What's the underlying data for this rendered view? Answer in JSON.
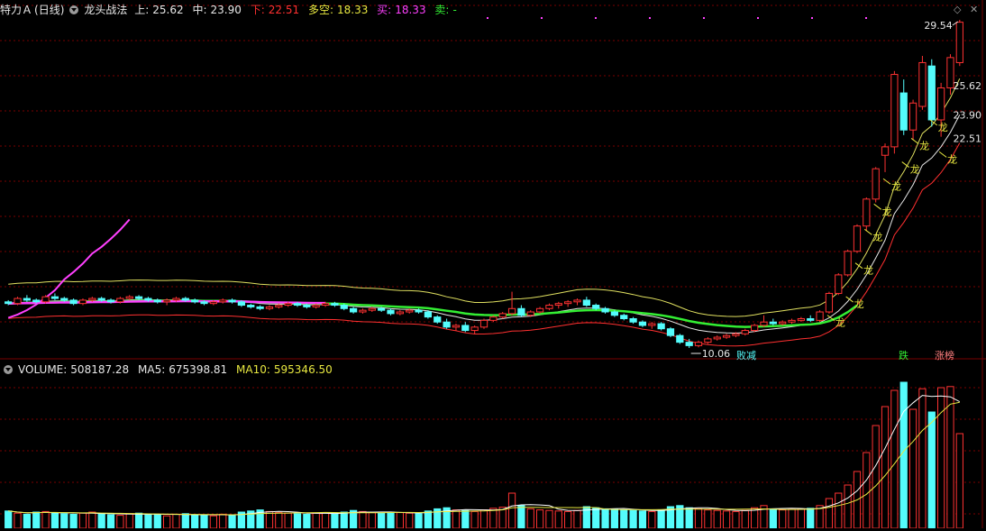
{
  "header": {
    "stock": "特力Ａ",
    "period": "(日线)",
    "indicator": "龙头战法",
    "upper_label": "上:",
    "upper_value": "25.62",
    "mid_label": "中:",
    "mid_value": "23.90",
    "lower_label": "下:",
    "lower_value": "22.51",
    "duokong_label": "多空:",
    "duokong_value": "18.33",
    "buy_label": "买:",
    "buy_value": "18.33",
    "sell_label": "卖:",
    "sell_value": "-"
  },
  "volume_header": {
    "label": "VOLUME:",
    "value": "508187.28",
    "ma5_label": "MA5:",
    "ma5_value": "675398.81",
    "ma10_label": "MA10:",
    "ma10_value": "595346.50"
  },
  "annotations": {
    "high_price": "29.54",
    "low_price": "10.06",
    "axis_upper": "25.62",
    "axis_mid": "23.90",
    "axis_lower": "22.51",
    "marker_long": "龙",
    "marker_bai": "败减",
    "marker_die": "跌",
    "marker_zhang": "涨榜"
  },
  "colors": {
    "up": "#ff3232",
    "down": "#54fcfc",
    "upper_band": "#e0e060",
    "mid_band": "#e8e8e8",
    "lower_band": "#ff3030",
    "duokong": "#ff40ff",
    "trend": "#33ee33",
    "ma5": "#ffffff",
    "ma10": "#e8e840",
    "grid": "#7a0000",
    "header_yellow": "#e8e840",
    "header_red": "#ff3030",
    "header_magenta": "#ff40ff",
    "header_green": "#33ee33"
  },
  "icons": {
    "dropdown": "chevron-down-icon",
    "diamond": "diamond-icon",
    "close": "close-icon"
  },
  "chart_data": {
    "type": "candlestick",
    "ylim": [
      10.06,
      29.54
    ],
    "candles": [
      [
        12.8,
        12.9,
        12.6,
        12.7
      ],
      [
        12.7,
        13.1,
        12.6,
        13.0
      ],
      [
        13.0,
        13.2,
        12.8,
        12.9
      ],
      [
        12.9,
        13.0,
        12.7,
        12.8
      ],
      [
        12.8,
        13.2,
        12.7,
        13.1
      ],
      [
        13.1,
        13.3,
        12.9,
        13.0
      ],
      [
        13.0,
        13.1,
        12.8,
        12.9
      ],
      [
        12.9,
        13.0,
        12.6,
        12.7
      ],
      [
        12.7,
        13.0,
        12.6,
        12.9
      ],
      [
        12.9,
        13.1,
        12.8,
        13.0
      ],
      [
        13.0,
        13.1,
        12.8,
        12.9
      ],
      [
        12.9,
        13.0,
        12.7,
        12.8
      ],
      [
        12.8,
        13.1,
        12.7,
        13.0
      ],
      [
        13.0,
        13.2,
        12.9,
        13.1
      ],
      [
        13.1,
        13.2,
        12.9,
        13.0
      ],
      [
        13.0,
        13.1,
        12.8,
        12.9
      ],
      [
        12.9,
        13.0,
        12.7,
        12.8
      ],
      [
        12.8,
        13.0,
        12.6,
        12.9
      ],
      [
        12.9,
        13.1,
        12.8,
        13.0
      ],
      [
        13.0,
        13.1,
        12.8,
        12.9
      ],
      [
        12.9,
        13.0,
        12.7,
        12.8
      ],
      [
        12.8,
        12.9,
        12.6,
        12.7
      ],
      [
        12.7,
        12.9,
        12.6,
        12.8
      ],
      [
        12.8,
        13.0,
        12.7,
        12.9
      ],
      [
        12.9,
        13.0,
        12.7,
        12.8
      ],
      [
        12.8,
        12.9,
        12.5,
        12.6
      ],
      [
        12.6,
        12.7,
        12.4,
        12.5
      ],
      [
        12.5,
        12.6,
        12.3,
        12.4
      ],
      [
        12.4,
        12.6,
        12.3,
        12.5
      ],
      [
        12.5,
        12.7,
        12.4,
        12.6
      ],
      [
        12.6,
        12.8,
        12.5,
        12.7
      ],
      [
        12.7,
        12.8,
        12.5,
        12.6
      ],
      [
        12.6,
        12.7,
        12.4,
        12.5
      ],
      [
        12.5,
        12.7,
        12.4,
        12.6
      ],
      [
        12.6,
        12.8,
        12.5,
        12.7
      ],
      [
        12.7,
        12.8,
        12.5,
        12.6
      ],
      [
        12.6,
        12.7,
        12.3,
        12.4
      ],
      [
        12.4,
        12.5,
        12.1,
        12.2
      ],
      [
        12.2,
        12.4,
        12.1,
        12.3
      ],
      [
        12.3,
        12.5,
        12.2,
        12.4
      ],
      [
        12.4,
        12.5,
        12.2,
        12.3
      ],
      [
        12.3,
        12.4,
        12.0,
        12.1
      ],
      [
        12.1,
        12.3,
        12.0,
        12.2
      ],
      [
        12.2,
        12.4,
        12.1,
        12.3
      ],
      [
        12.3,
        12.4,
        12.1,
        12.2
      ],
      [
        12.2,
        12.3,
        11.8,
        11.9
      ],
      [
        11.9,
        12.0,
        11.5,
        11.6
      ],
      [
        11.6,
        11.8,
        11.2,
        11.3
      ],
      [
        11.3,
        11.5,
        11.1,
        11.4
      ],
      [
        11.4,
        11.6,
        11.0,
        11.1
      ],
      [
        11.1,
        11.4,
        10.9,
        11.3
      ],
      [
        11.3,
        11.8,
        11.2,
        11.7
      ],
      [
        11.7,
        12.0,
        11.6,
        11.9
      ],
      [
        11.9,
        12.2,
        11.8,
        12.1
      ],
      [
        12.1,
        13.4,
        12.0,
        12.4
      ],
      [
        12.4,
        12.6,
        11.9,
        12.0
      ],
      [
        12.0,
        12.3,
        11.9,
        12.2
      ],
      [
        12.2,
        12.5,
        12.1,
        12.4
      ],
      [
        12.4,
        12.7,
        12.3,
        12.6
      ],
      [
        12.6,
        12.8,
        12.4,
        12.7
      ],
      [
        12.7,
        12.9,
        12.5,
        12.8
      ],
      [
        12.8,
        13.0,
        12.6,
        12.9
      ],
      [
        12.9,
        13.1,
        12.5,
        12.6
      ],
      [
        12.6,
        12.7,
        12.3,
        12.4
      ],
      [
        12.4,
        12.5,
        12.1,
        12.2
      ],
      [
        12.2,
        12.3,
        11.9,
        12.0
      ],
      [
        12.0,
        12.1,
        11.7,
        11.8
      ],
      [
        11.8,
        11.9,
        11.5,
        11.6
      ],
      [
        11.6,
        11.7,
        11.3,
        11.4
      ],
      [
        11.4,
        11.6,
        11.2,
        11.5
      ],
      [
        11.5,
        11.6,
        11.1,
        11.2
      ],
      [
        11.2,
        11.3,
        10.7,
        10.8
      ],
      [
        10.8,
        10.9,
        10.3,
        10.4
      ],
      [
        10.4,
        10.6,
        10.06,
        10.2
      ],
      [
        10.2,
        10.5,
        10.1,
        10.4
      ],
      [
        10.4,
        10.7,
        10.3,
        10.6
      ],
      [
        10.6,
        10.8,
        10.5,
        10.7
      ],
      [
        10.7,
        10.9,
        10.6,
        10.8
      ],
      [
        10.8,
        11.0,
        10.7,
        10.9
      ],
      [
        10.9,
        11.2,
        10.8,
        11.1
      ],
      [
        11.1,
        11.5,
        11.0,
        11.4
      ],
      [
        11.4,
        12.0,
        11.3,
        11.6
      ],
      [
        11.6,
        11.8,
        11.4,
        11.5
      ],
      [
        11.5,
        11.7,
        11.4,
        11.6
      ],
      [
        11.6,
        11.8,
        11.5,
        11.7
      ],
      [
        11.7,
        11.9,
        11.6,
        11.8
      ],
      [
        11.8,
        12.0,
        11.6,
        11.7
      ],
      [
        11.7,
        12.3,
        11.6,
        12.2
      ],
      [
        12.2,
        13.4,
        12.1,
        13.3
      ],
      [
        13.3,
        14.5,
        13.2,
        14.4
      ],
      [
        14.4,
        15.9,
        14.3,
        15.8
      ],
      [
        15.8,
        17.4,
        15.7,
        17.3
      ],
      [
        17.3,
        19.0,
        17.0,
        18.9
      ],
      [
        18.9,
        20.8,
        18.7,
        20.7
      ],
      [
        21.5,
        22.2,
        20.5,
        22.0
      ],
      [
        22.0,
        26.5,
        21.6,
        26.3
      ],
      [
        25.2,
        26.0,
        22.7,
        23.0
      ],
      [
        23.0,
        24.8,
        22.4,
        24.6
      ],
      [
        24.4,
        27.4,
        24.2,
        27.0
      ],
      [
        26.8,
        27.2,
        23.2,
        23.6
      ],
      [
        23.6,
        25.8,
        22.6,
        25.5
      ],
      [
        25.5,
        27.5,
        25.1,
        27.3
      ],
      [
        27.0,
        29.54,
        26.8,
        29.4
      ]
    ],
    "volume": [
      320000,
      280000,
      260000,
      300000,
      310000,
      290000,
      270000,
      260000,
      280000,
      300000,
      260000,
      250000,
      240000,
      270000,
      280000,
      260000,
      250000,
      230000,
      260000,
      270000,
      250000,
      240000,
      230000,
      260000,
      250000,
      300000,
      320000,
      340000,
      310000,
      290000,
      280000,
      270000,
      260000,
      280000,
      290000,
      270000,
      300000,
      330000,
      310000,
      290000,
      280000,
      300000,
      290000,
      280000,
      270000,
      320000,
      360000,
      380000,
      340000,
      330000,
      310000,
      340000,
      370000,
      390000,
      650000,
      420000,
      360000,
      340000,
      330000,
      320000,
      310000,
      330000,
      400000,
      380000,
      360000,
      350000,
      340000,
      330000,
      320000,
      310000,
      340000,
      400000,
      420000,
      380000,
      360000,
      340000,
      330000,
      320000,
      310000,
      330000,
      380000,
      420000,
      360000,
      340000,
      350000,
      360000,
      370000,
      420000,
      550000,
      650000,
      800000,
      1050000,
      1400000,
      1900000,
      2250000,
      2550000,
      2700000,
      2200000,
      2580000,
      2150000,
      2600000,
      2620000,
      1750000
    ],
    "volume_ylim": [
      0,
      2800000
    ],
    "volume_header_value": 508187.28,
    "ma5_last": 675398.81,
    "ma10_last": 595346.5
  }
}
